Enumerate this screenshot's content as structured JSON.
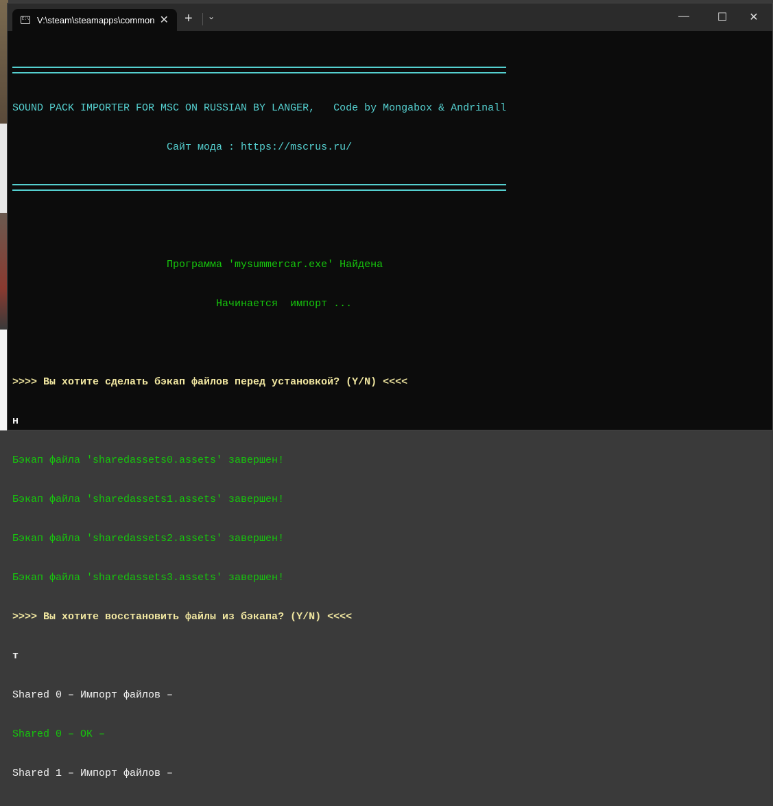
{
  "window": {
    "tab_title": "V:\\steam\\steamapps\\common",
    "tab_icon": "terminal-icon",
    "new_tab": "+",
    "minimize": "—",
    "maximize": "☐",
    "close": "✕"
  },
  "console": {
    "header1": "SOUND PACK IMPORTER FOR MSC ON RUSSIAN BY LANGER,   Code by Mongabox & Andrinall",
    "header2": "                         Сайт мода : https://mscrus.ru/",
    "found": "                         Программа 'mysummercar.exe' Найдена",
    "starting": "                                 Начинается  импорт ...",
    "prompt_backup": ">>>> Вы хотите сделать бэкап файлов перед установкой? (Y/N) <<<<",
    "answer1": "н",
    "backup_lines": [
      "Бэкап файла 'sharedassets0.assets' завершен!",
      "Бэкап файла 'sharedassets1.assets' завершен!",
      "Бэкап файла 'sharedassets2.assets' завершен!",
      "Бэкап файла 'sharedassets3.assets' завершен!"
    ],
    "prompt_restore": ">>>> Вы хотите восстановить файлы из бэкапа? (Y/N) <<<<",
    "answer2": "т",
    "import0": "Shared 0 – Импорт файлов –",
    "ok0": "Shared 0 – ОК –",
    "import1": "Shared 1 – Импорт файлов –"
  }
}
